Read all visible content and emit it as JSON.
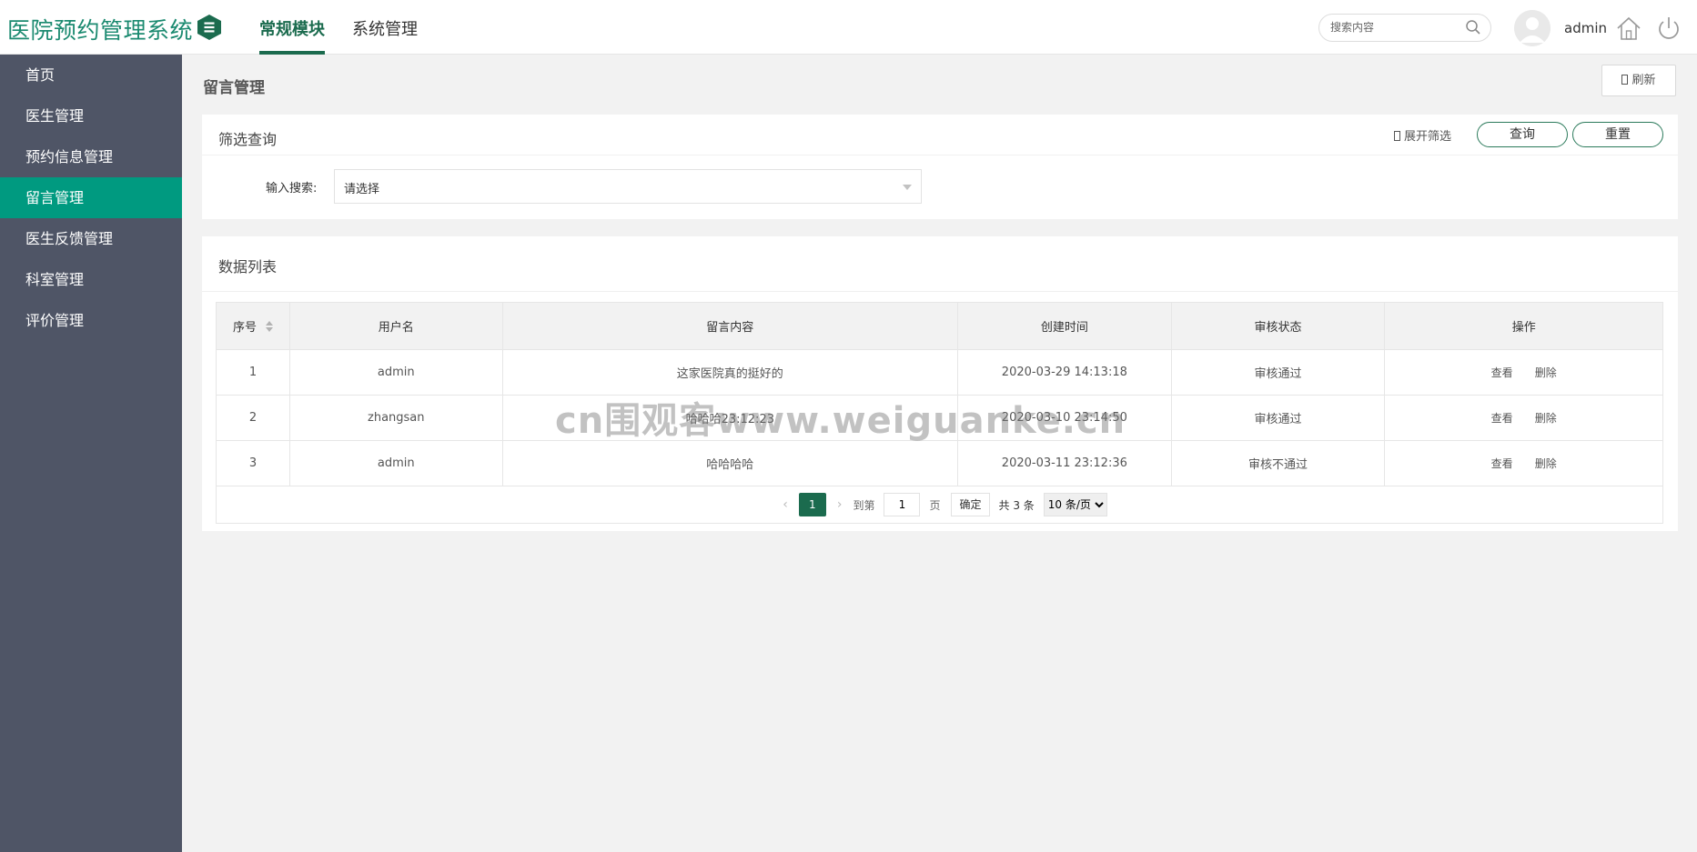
{
  "header": {
    "brand": "医院预约管理系统",
    "tabs": [
      {
        "label": "常规模块",
        "active": true
      },
      {
        "label": "系统管理",
        "active": false
      }
    ],
    "search_placeholder": "搜索内容",
    "username": "admin",
    "icons": [
      "menu-toggle-icon",
      "search-icon",
      "avatar-icon",
      "home-icon",
      "power-icon"
    ]
  },
  "sidebar": {
    "items": [
      {
        "label": "首页",
        "active": false
      },
      {
        "label": "医生管理",
        "active": false
      },
      {
        "label": "预约信息管理",
        "active": false
      },
      {
        "label": "留言管理",
        "active": true
      },
      {
        "label": "医生反馈管理",
        "active": false
      },
      {
        "label": "科室管理",
        "active": false
      },
      {
        "label": "评价管理",
        "active": false
      }
    ]
  },
  "main": {
    "page_title": "留言管理",
    "refresh_label": "刷新",
    "filter": {
      "title": "筛选查询",
      "expand_label": "展开筛选",
      "query_label": "查询",
      "reset_label": "重置",
      "search_label": "输入搜索:",
      "select_value": "请选择"
    },
    "list": {
      "title": "数据列表",
      "columns": [
        "序号",
        "用户名",
        "留言内容",
        "创建时间",
        "审核状态",
        "操作"
      ],
      "rows": [
        {
          "id": "1",
          "user": "admin",
          "content": "这家医院真的挺好的",
          "created": "2020-03-29 14:13:18",
          "status": "审核通过",
          "view": "查看",
          "delete": "删除"
        },
        {
          "id": "2",
          "user": "zhangsan",
          "content": "哈哈哈23:12:23",
          "created": "2020-03-10 23:14:50",
          "status": "审核通过",
          "view": "查看",
          "delete": "删除"
        },
        {
          "id": "3",
          "user": "admin",
          "content": "哈哈哈哈",
          "created": "2020-03-11 23:12:36",
          "status": "审核不通过",
          "view": "查看",
          "delete": "删除"
        }
      ],
      "pager": {
        "current": "1",
        "goto_label": "到第",
        "goto_value": "1",
        "page_unit": "页",
        "confirm_label": "确定",
        "total_label": "共 3 条",
        "page_size": "10 条/页"
      }
    }
  },
  "watermark": "cn围观客www.weiguanke.cn",
  "colors": {
    "primary": "#1b6b4e",
    "sidebar_bg": "#4f5566",
    "sidebar_active": "#009a80",
    "brand": "#1b8a70"
  }
}
